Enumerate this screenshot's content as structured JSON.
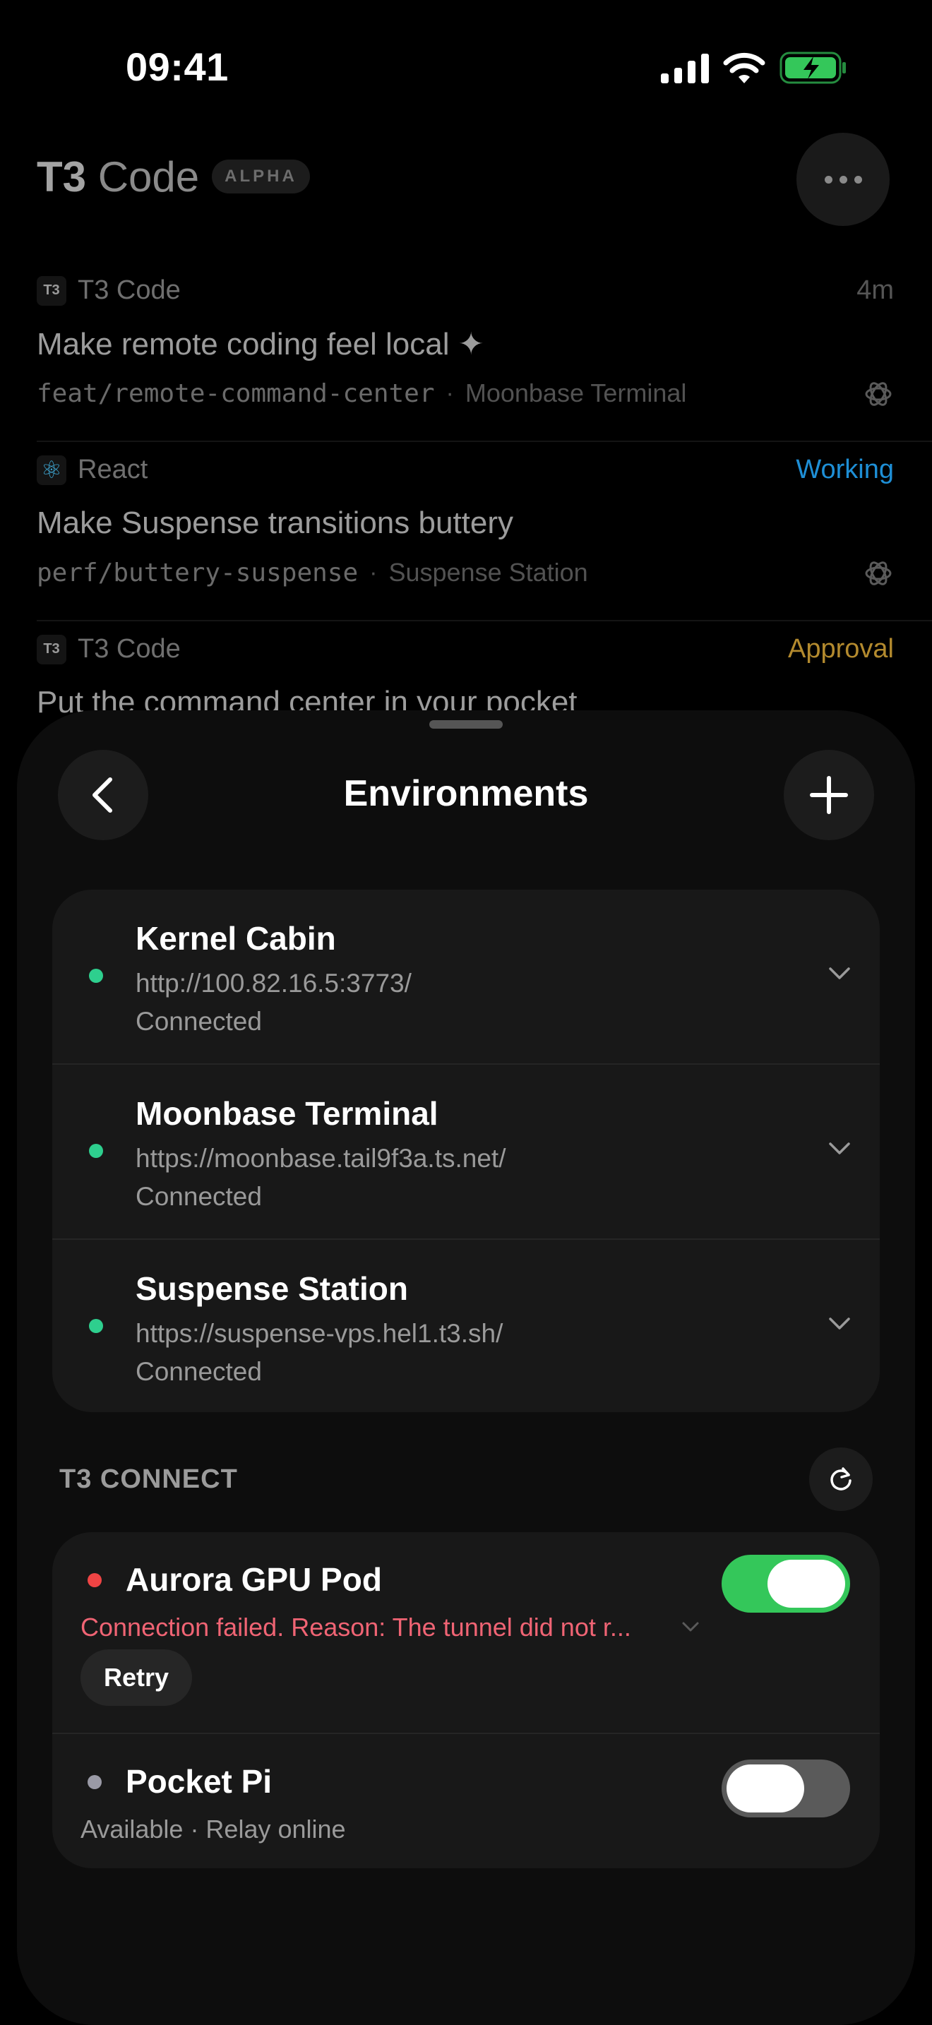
{
  "status_bar": {
    "time": "09:41"
  },
  "header": {
    "title_bold": "T3",
    "title_rest": "Code",
    "badge": "ALPHA"
  },
  "threads": [
    {
      "project": "T3 Code",
      "project_icon": "T3",
      "status": "4m",
      "status_color": "#555555",
      "title": "Make remote coding feel local ✦",
      "branch": "feat/remote-command-center",
      "separator": "·",
      "environment": "Moonbase Terminal"
    },
    {
      "project": "React",
      "project_icon": "⚛",
      "status": "Working",
      "status_color": "#1e8fd6",
      "title": "Make Suspense transitions buttery",
      "branch": "perf/buttery-suspense",
      "separator": "·",
      "environment": "Suspense Station"
    },
    {
      "project": "T3 Code",
      "project_icon": "T3",
      "status": "Approval",
      "status_color": "#b38a2e",
      "title": "Put the command center in your pocket"
    }
  ],
  "sheet": {
    "title": "Environments",
    "environments": [
      {
        "name": "Kernel Cabin",
        "url": "http://100.82.16.5:3773/",
        "state": "Connected",
        "dot_color": "#2ecf8e"
      },
      {
        "name": "Moonbase Terminal",
        "url": "https://moonbase.tail9f3a.ts.net/",
        "state": "Connected",
        "dot_color": "#2ecf8e"
      },
      {
        "name": "Suspense Station",
        "url": "https://suspense-vps.hel1.t3.sh/",
        "state": "Connected",
        "dot_color": "#2ecf8e"
      }
    ],
    "connect_section_label": "T3 CONNECT",
    "connections": [
      {
        "name": "Aurora GPU Pod",
        "error": "Connection failed. Reason: The tunnel did not r...",
        "retry_label": "Retry",
        "enabled": true,
        "dot_color": "#ef4444"
      },
      {
        "name": "Pocket Pi",
        "subtitle": "Available · Relay online",
        "enabled": false,
        "dot_color": "#9a9aa6"
      }
    ]
  },
  "colors": {
    "accent_green": "#34c75a",
    "error_red": "#f06474",
    "connected_green": "#2ecf8e"
  },
  "icons": [
    "signal-icon",
    "wifi-icon",
    "battery-charging-icon",
    "more-icon",
    "openai-icon",
    "back-chevron-icon",
    "plus-icon",
    "chevron-down-icon",
    "refresh-icon"
  ]
}
